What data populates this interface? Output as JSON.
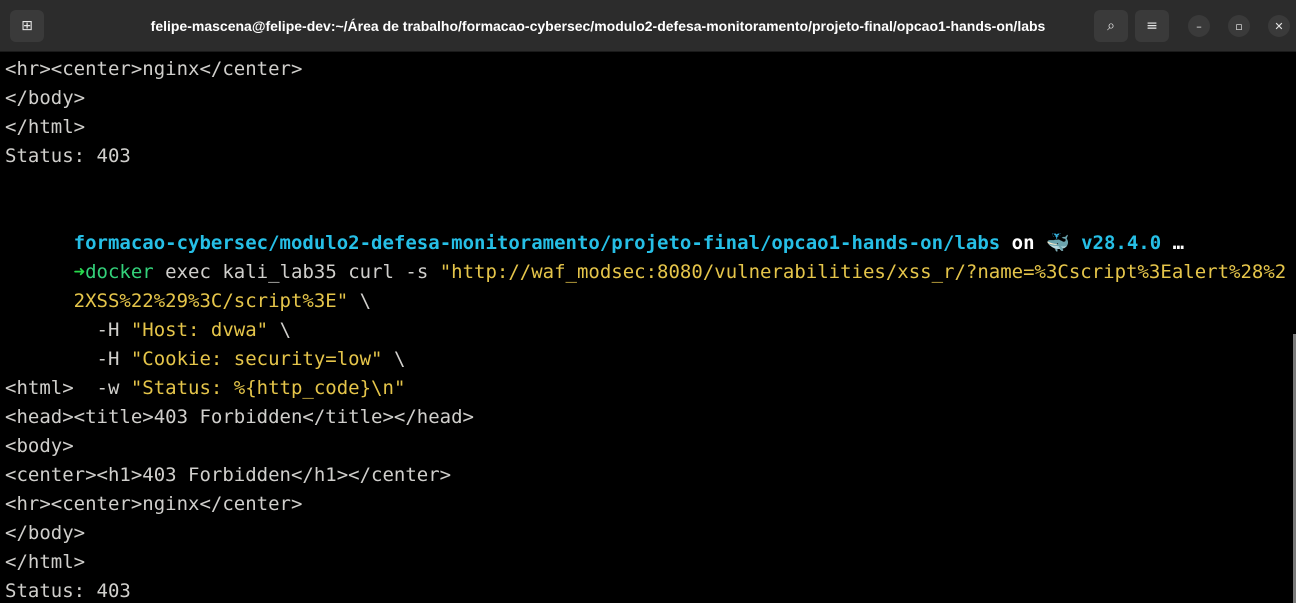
{
  "window": {
    "title": "felipe-mascena@felipe-dev:~/Área de trabalho/formacao-cybersec/modulo2-defesa-monitoramento/projeto-final/opcao1-hands-on/labs",
    "icons": {
      "new_tab": "new-tab-icon",
      "search": "search-icon",
      "menu": "hamburger-menu-icon",
      "minimize": "minimize-icon",
      "maximize": "maximize-icon",
      "close": "close-icon"
    },
    "glyphs": {
      "new_tab": "⊞",
      "search": "⌕",
      "menu": "≡",
      "minimize": "–",
      "maximize": "▫",
      "close": "✕"
    }
  },
  "terminal": {
    "output_before": [
      "<hr><center>nginx</center>",
      "</body>",
      "</html>",
      "Status: 403",
      ""
    ],
    "prompt": {
      "path": "formacao-cybersec/modulo2-defesa-monitoramento/projeto-final/opcao1-hands-on/labs",
      "on": " on ",
      "whale": "🐳",
      "version": " v28.4.0",
      "ellipsis": " …",
      "arrow": "➜",
      "command": "docker",
      "args": " exec kali_lab35 curl -s ",
      "url_part1": "\"http://waf_modsec:8080/vulnerabilities/xss_r/?name=%3Cscript%3Ealert%28%2",
      "url_part2": "2XSS%22%29%3C/script%3E\"",
      "url_tail": " \\"
    },
    "cmd_lines": [
      {
        "flag": "  -H ",
        "value": "\"Host: dvwa\"",
        "tail": " \\"
      },
      {
        "flag": "  -H ",
        "value": "\"Cookie: security=low\"",
        "tail": " \\"
      },
      {
        "flag": "  -w ",
        "value": "\"Status: %{http_code}\\n\"",
        "tail": ""
      }
    ],
    "output_after": [
      "<html>",
      "<head><title>403 Forbidden</title></head>",
      "<body>",
      "<center><h1>403 Forbidden</h1></center>",
      "<hr><center>nginx</center>",
      "</body>",
      "</html>",
      "Status: 403"
    ]
  },
  "colors": {
    "background": "#000000",
    "titlebar": "#2c2c2c",
    "text": "#d0cfcc",
    "prompt_path": "#26bfe6",
    "arrow": "#26d94a",
    "command": "#33d17a",
    "string": "#e5c54a"
  }
}
